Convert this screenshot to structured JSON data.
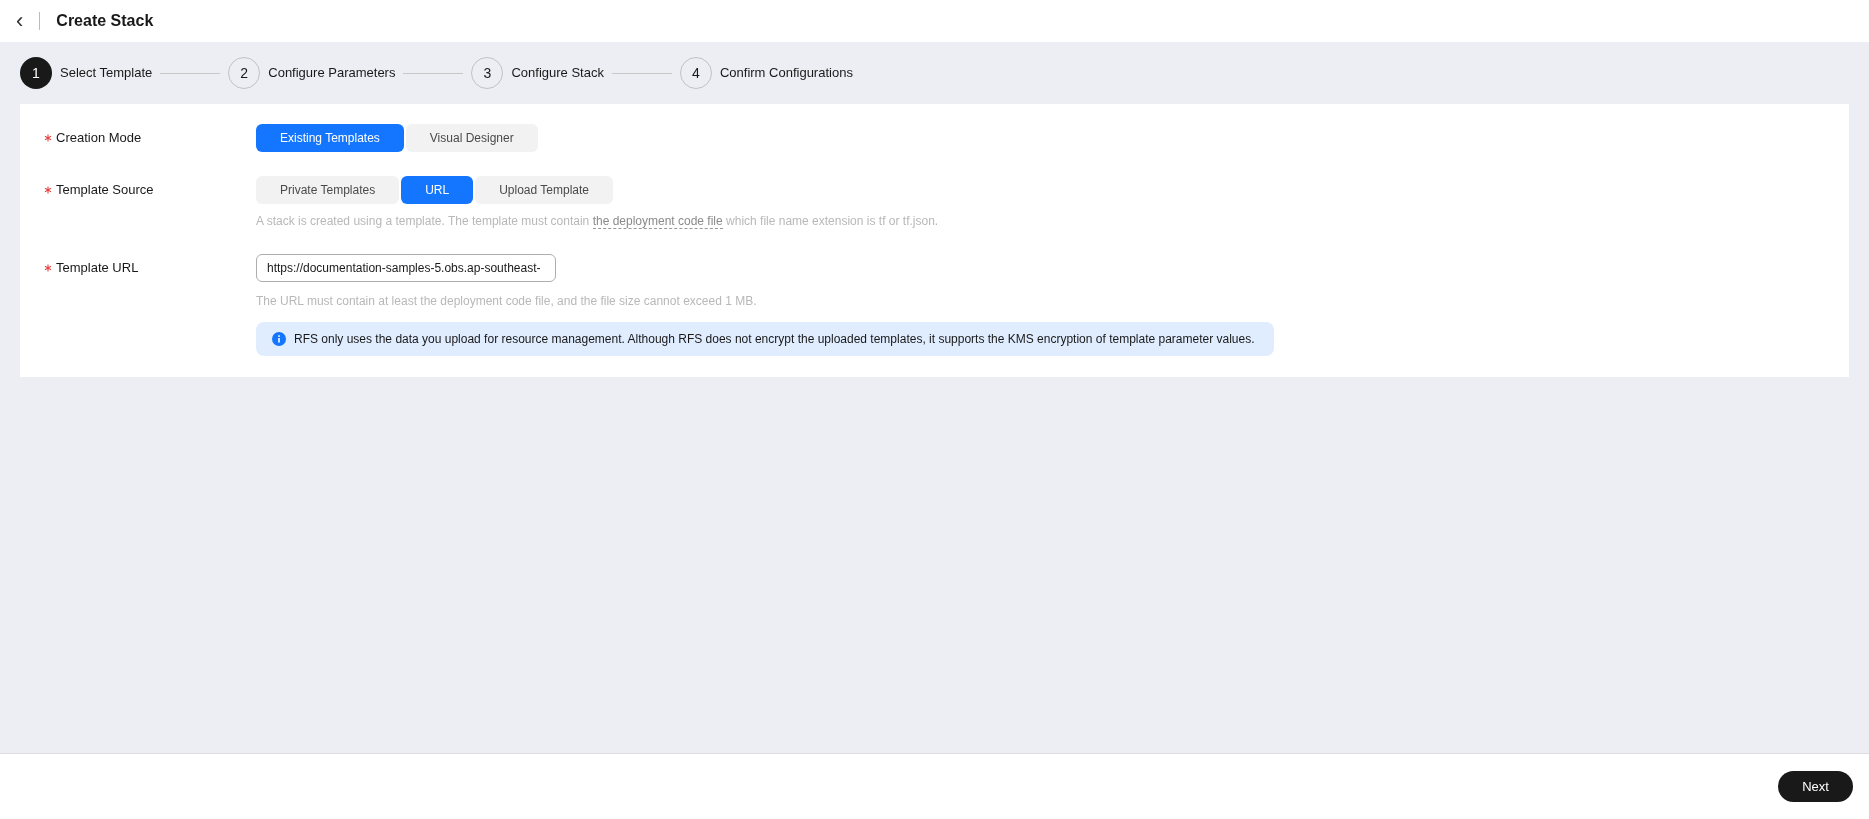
{
  "header": {
    "back_icon": "‹",
    "title": "Create Stack"
  },
  "steps": [
    {
      "number": "1",
      "label": "Select Template",
      "selected": true
    },
    {
      "number": "2",
      "label": "Configure Parameters",
      "selected": false
    },
    {
      "number": "3",
      "label": "Configure Stack",
      "selected": false
    },
    {
      "number": "4",
      "label": "Confirm Configurations",
      "selected": false
    }
  ],
  "form": {
    "creation_mode": {
      "label": "Creation Mode",
      "required": true,
      "options": [
        {
          "label": "Existing Templates",
          "selected": true
        },
        {
          "label": "Visual Designer",
          "selected": false
        }
      ]
    },
    "template_source": {
      "label": "Template Source",
      "required": true,
      "options": [
        {
          "label": "Private Templates",
          "selected": false
        },
        {
          "label": "URL",
          "selected": true
        },
        {
          "label": "Upload Template",
          "selected": false
        }
      ],
      "hint": {
        "before": "A stack is created using a template. The template must contain ",
        "link": "the deployment code file",
        "after": " which file name extension is tf or tf.json."
      }
    },
    "template_url": {
      "label": "Template URL",
      "required": true,
      "value": "https://documentation-samples-5.obs.ap-southeast-",
      "hint": "The URL must contain at least the deployment code file, and the file size cannot exceed 1 MB."
    },
    "info": "RFS only uses the data you upload for resource management. Although RFS does not encrypt the uploaded templates, it supports the KMS encryption of template parameter values."
  },
  "footer": {
    "next": "Next"
  }
}
